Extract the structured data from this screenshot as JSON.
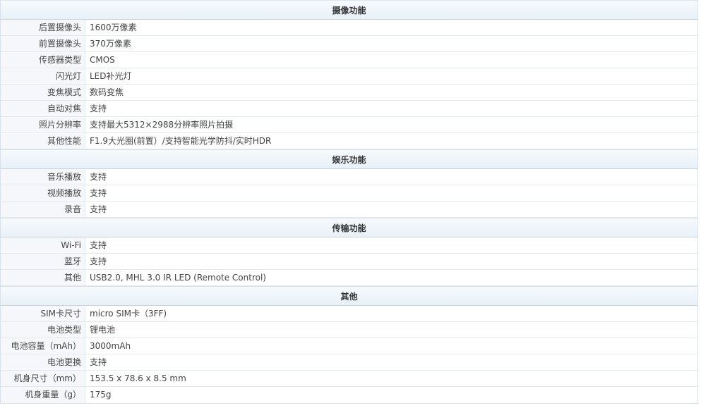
{
  "sections": [
    {
      "title": "摄像功能",
      "rows": [
        {
          "label": "后置摄像头",
          "value": "1600万像素"
        },
        {
          "label": "前置摄像头",
          "value": "370万像素"
        },
        {
          "label": "传感器类型",
          "value": "CMOS"
        },
        {
          "label": "闪光灯",
          "value": "LED补光灯"
        },
        {
          "label": "变焦模式",
          "value": "数码变焦"
        },
        {
          "label": "自动对焦",
          "value": "支持"
        },
        {
          "label": "照片分辨率",
          "value": "支持最大5312×2988分辨率照片拍摄"
        },
        {
          "label": "其他性能",
          "value": "F1.9大光圈(前置）/支持智能光学防抖/实时HDR"
        }
      ]
    },
    {
      "title": "娱乐功能",
      "rows": [
        {
          "label": "音乐播放",
          "value": "支持"
        },
        {
          "label": "视频播放",
          "value": "支持"
        },
        {
          "label": "录音",
          "value": "支持"
        }
      ]
    },
    {
      "title": "传输功能",
      "rows": [
        {
          "label": "Wi-Fi",
          "value": "支持"
        },
        {
          "label": "蓝牙",
          "value": "支持"
        },
        {
          "label": "其他",
          "value": "USB2.0, MHL 3.0 IR LED (Remote Control)"
        }
      ]
    },
    {
      "title": "其他",
      "rows": [
        {
          "label": "SIM卡尺寸",
          "value": "micro SIM卡（3FF)"
        },
        {
          "label": "电池类型",
          "value": "锂电池"
        },
        {
          "label": "电池容量（mAh）",
          "value": "3000mAh"
        },
        {
          "label": "电池更换",
          "value": "支持"
        },
        {
          "label": "机身尺寸（mm）",
          "value": "153.5 x 78.6 x 8.5 mm"
        },
        {
          "label": "机身重量（g）",
          "value": "175g"
        }
      ]
    }
  ]
}
